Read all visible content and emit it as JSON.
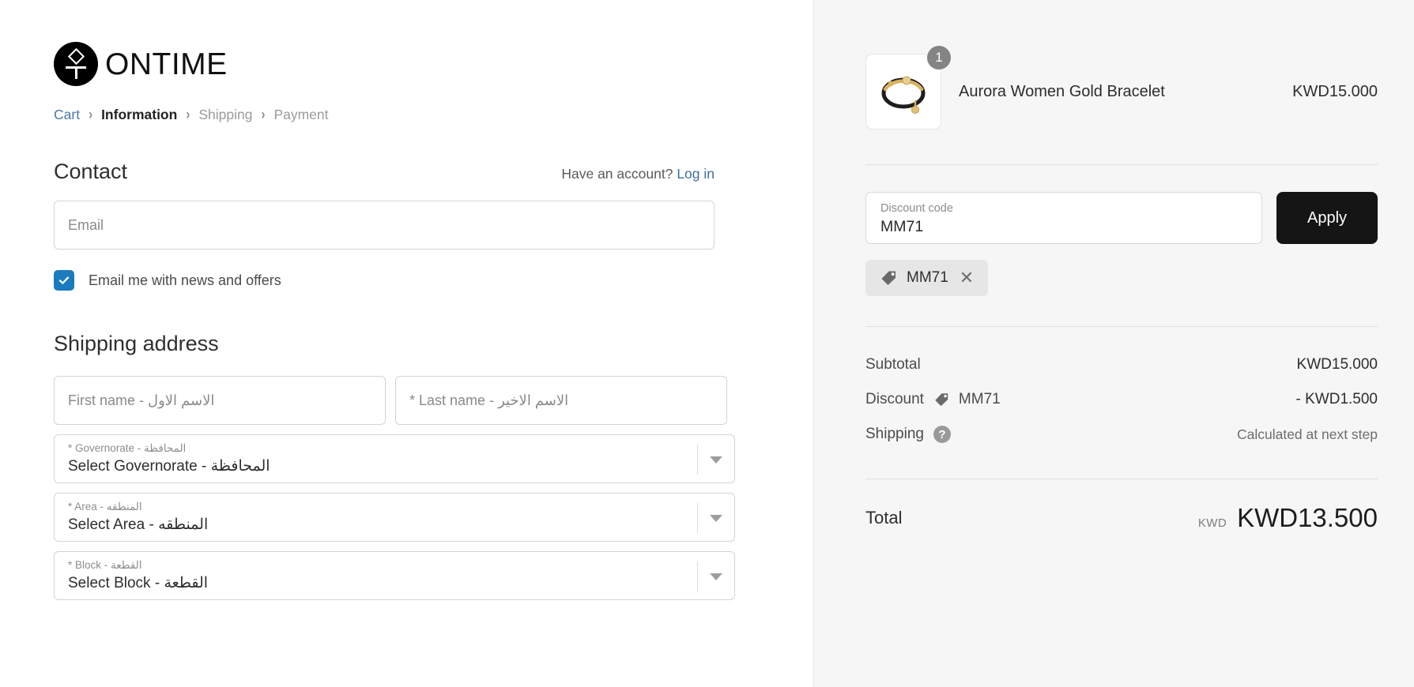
{
  "brand": {
    "name": "ONTIME",
    "logo_icon": "ontime-logo-icon"
  },
  "breadcrumb": {
    "items": [
      {
        "label": "Cart",
        "state": "link"
      },
      {
        "label": "Information",
        "state": "current"
      },
      {
        "label": "Shipping",
        "state": "future"
      },
      {
        "label": "Payment",
        "state": "future"
      }
    ],
    "separator": "›"
  },
  "contact": {
    "title": "Contact",
    "account_prompt": "Have an account?",
    "login_label": "Log in",
    "email_placeholder": "Email",
    "newsletter_label": "Email me with news and offers",
    "newsletter_checked": true
  },
  "shipping_address": {
    "title": "Shipping address",
    "first_name_placeholder": "First name - الاسم الاول",
    "last_name_placeholder": "* Last name - الاسم الاخير",
    "selects": [
      {
        "label": "* Governorate - المحافظة",
        "value": "Select Governorate - المحافظة"
      },
      {
        "label": "* Area - المنطقه",
        "value": "Select Area - المنطقه"
      },
      {
        "label": "* Block - القطعة",
        "value": "Select Block - القطعة"
      }
    ]
  },
  "order_summary": {
    "line_item": {
      "name": "Aurora Women Gold Bracelet",
      "price": "KWD15.000",
      "quantity": "1",
      "image_icon": "bracelet-thumbnail"
    },
    "discount_input": {
      "label": "Discount code",
      "value": "MM71",
      "apply_label": "Apply"
    },
    "applied_tag": {
      "code": "MM71",
      "tag_icon": "tag-icon",
      "remove_icon": "✕"
    },
    "rows": [
      {
        "label": "Subtotal",
        "value": "KWD15.000",
        "icon": null,
        "muted": false
      },
      {
        "label": "Discount",
        "value": "- KWD1.500",
        "icon": "tag-icon",
        "code": "MM71",
        "muted": false
      },
      {
        "label": "Shipping",
        "value": "Calculated at next step",
        "icon": "help-icon",
        "muted": true
      }
    ],
    "total": {
      "label": "Total",
      "currency": "KWD",
      "amount": "KWD13.500"
    }
  },
  "colors": {
    "accent_blue": "#1b7bbd",
    "link_blue": "#3f6e9e",
    "apply_button": "#151515",
    "panel_bg": "#f6f6f6"
  }
}
